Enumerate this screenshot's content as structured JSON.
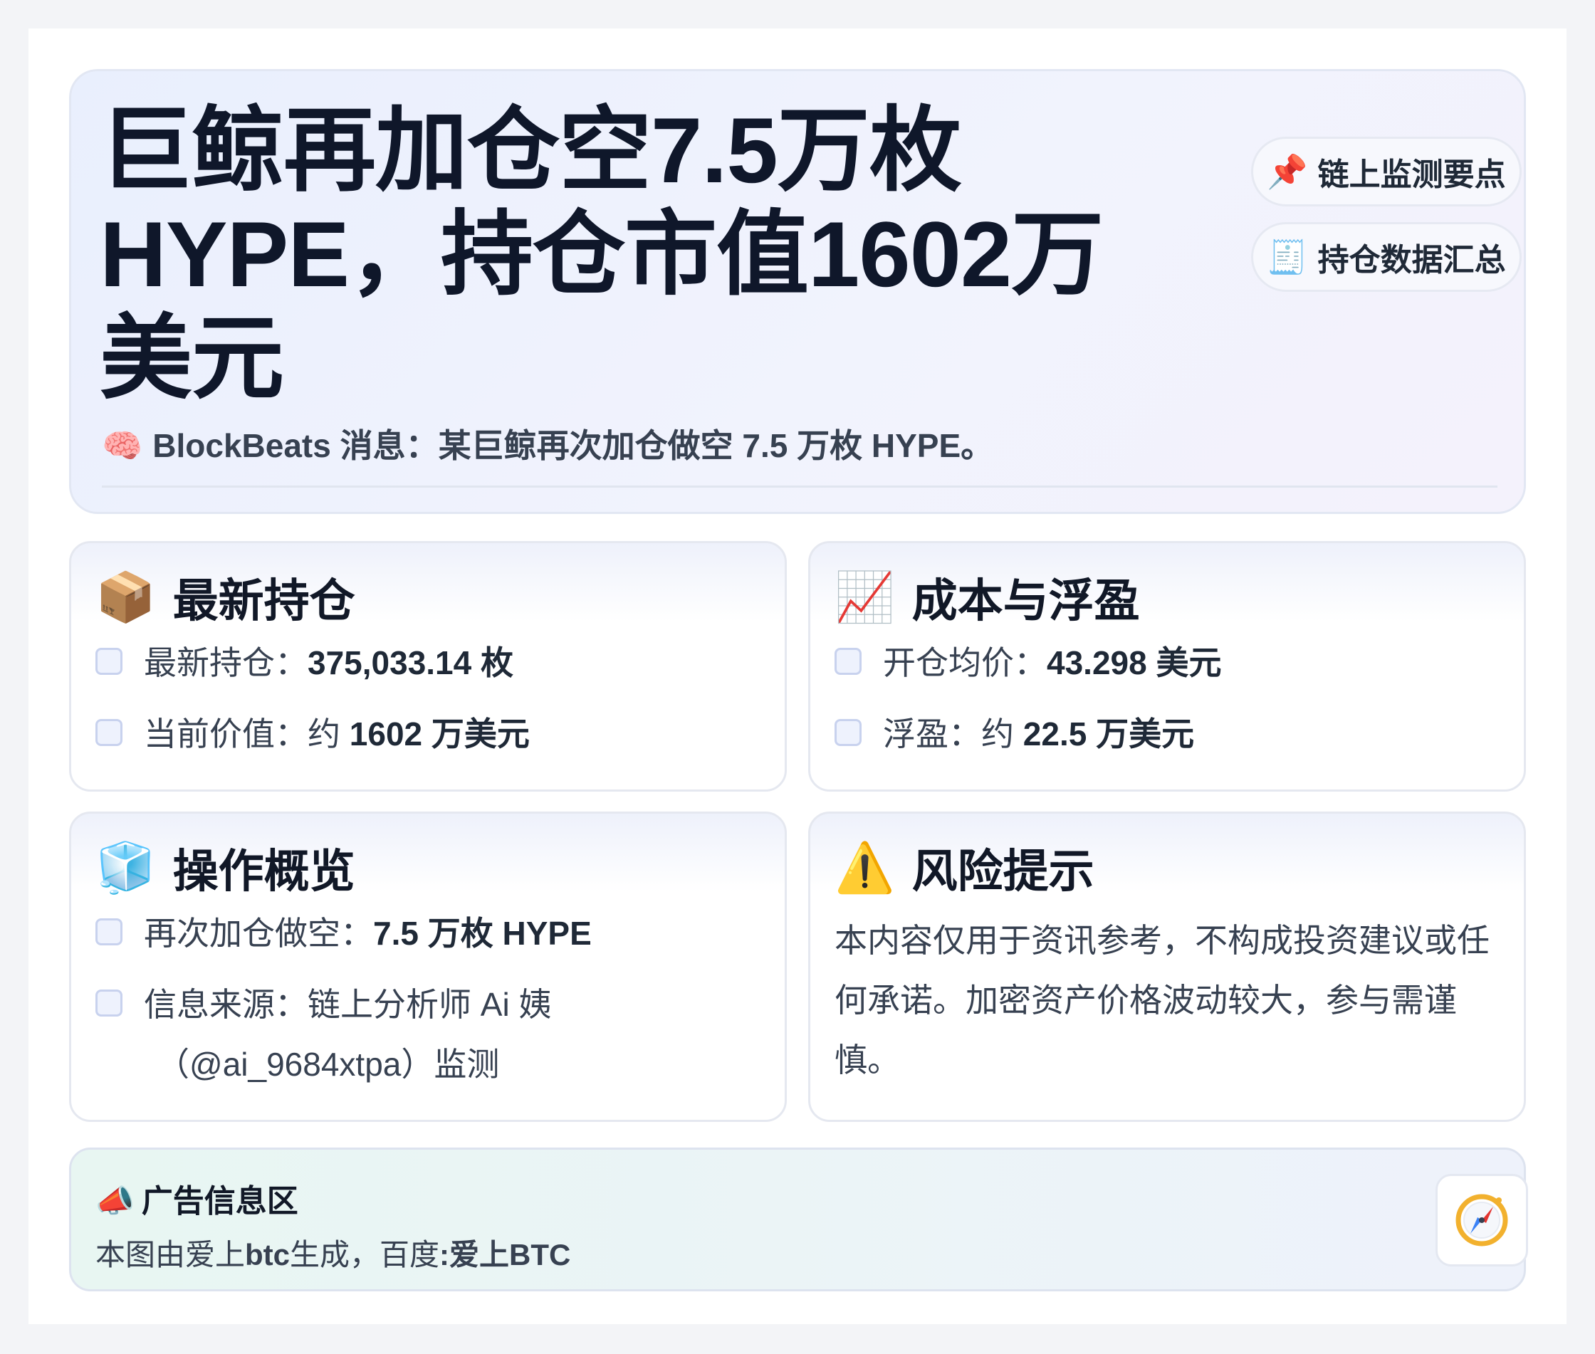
{
  "hero": {
    "title": "巨鲸再加仓空7.5万枚HYPE，持仓市值1602万美元",
    "subtitle_emoji": "🧠",
    "subtitle": "BlockBeats 消息：某巨鲸再次加仓做空 7.5 万枚 HYPE。",
    "pills": [
      {
        "emoji": "📌",
        "label": "链上监测要点"
      },
      {
        "emoji": "🧾",
        "label": "持仓数据汇总"
      }
    ]
  },
  "cards": {
    "position": {
      "emoji": "📦",
      "title": "最新持仓",
      "items": [
        {
          "label": "最新持仓：",
          "value": "375,033.14 枚"
        },
        {
          "label": "当前价值：约 ",
          "value": "1602 万美元"
        }
      ]
    },
    "cost": {
      "emoji": "📈",
      "title": "成本与浮盈",
      "items": [
        {
          "label": "开仓均价：",
          "value": "43.298 美元"
        },
        {
          "label": "浮盈：约 ",
          "value": "22.5 万美元"
        }
      ]
    },
    "ops": {
      "emoji": "🧊",
      "title": "操作概览",
      "items": [
        {
          "label": "再次加仓做空：",
          "value": "7.5 万枚 HYPE"
        },
        {
          "label": "信息来源：链上分析师 Ai 姨",
          "line2": "（@ai_9684xtpa）监测"
        }
      ]
    },
    "risk": {
      "emoji": "⚠️",
      "title": "风险提示",
      "text": "本内容仅用于资讯参考，不构成投资建议或任何承诺。加密资产价格波动较大，参与需谨慎。"
    }
  },
  "ad": {
    "emoji": "📣",
    "title": "广告信息区",
    "text_prefix": "本图由爱上",
    "text_brand1": "btc",
    "text_middle": "生成，百度",
    "text_brand2": ":爱上BTC",
    "button_icon": "compass-icon"
  }
}
